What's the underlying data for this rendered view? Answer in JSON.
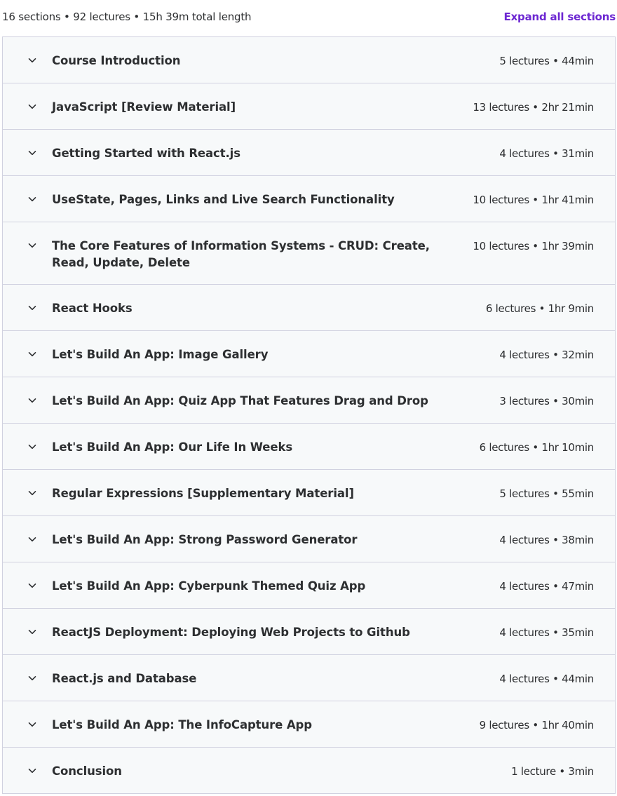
{
  "summary": "16 sections • 92 lectures • 15h 39m total length",
  "expand_all_label": "Expand all sections",
  "icons": {
    "chevron": "chevron-down-icon"
  },
  "colors": {
    "accent": "#6d28d2",
    "row_background": "#f7f9fa",
    "border": "#d1d2e0",
    "text": "#2d2f31"
  },
  "sections": [
    {
      "title": "Course Introduction",
      "meta": "5 lectures • 44min"
    },
    {
      "title": "JavaScript [Review Material]",
      "meta": "13 lectures • 2hr 21min"
    },
    {
      "title": "Getting Started with React.js",
      "meta": "4 lectures • 31min"
    },
    {
      "title": "UseState, Pages, Links and Live Search Functionality",
      "meta": "10 lectures • 1hr 41min"
    },
    {
      "title": "The Core Features of Information Systems - CRUD: Create, Read, Update, Delete",
      "meta": "10 lectures • 1hr 39min"
    },
    {
      "title": "React Hooks",
      "meta": "6 lectures • 1hr 9min"
    },
    {
      "title": "Let's Build An App: Image Gallery",
      "meta": "4 lectures • 32min"
    },
    {
      "title": "Let's Build An App: Quiz App That Features Drag and Drop",
      "meta": "3 lectures • 30min"
    },
    {
      "title": "Let's Build An App: Our Life In Weeks",
      "meta": "6 lectures • 1hr 10min"
    },
    {
      "title": "Regular Expressions [Supplementary Material]",
      "meta": "5 lectures • 55min"
    },
    {
      "title": "Let's Build An App: Strong Password Generator",
      "meta": "4 lectures • 38min"
    },
    {
      "title": "Let's Build An App: Cyberpunk Themed Quiz App",
      "meta": "4 lectures • 47min"
    },
    {
      "title": "ReactJS Deployment: Deploying Web Projects to Github",
      "meta": "4 lectures • 35min"
    },
    {
      "title": "React.js and Database",
      "meta": "4 lectures • 44min"
    },
    {
      "title": "Let's Build An App: The InfoCapture App",
      "meta": "9 lectures • 1hr 40min"
    },
    {
      "title": "Conclusion",
      "meta": "1 lecture • 3min"
    }
  ]
}
